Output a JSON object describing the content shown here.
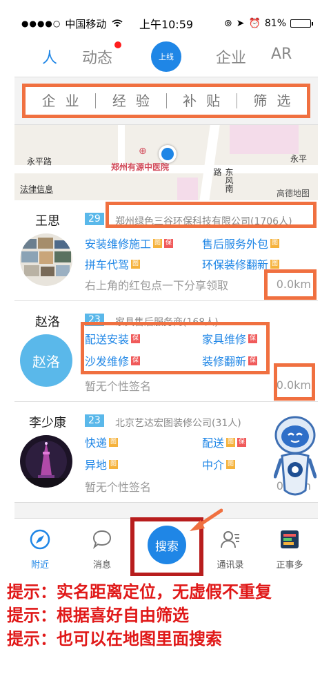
{
  "status": {
    "carrier": "中国移动",
    "time": "上午10:59",
    "battery": "81%",
    "battery_level": 0.81
  },
  "topnav": {
    "tabs": [
      "人",
      "动态",
      "企业",
      "AR"
    ],
    "active": "人",
    "online_label": "上线"
  },
  "filters": [
    "企业",
    "经验",
    "补贴",
    "筛选"
  ],
  "map": {
    "roads": [
      "永平路",
      "永平路",
      "东风南路",
      "法律信息",
      "永平"
    ],
    "poi": "郑州有源中医院",
    "brand": "高德地图"
  },
  "people": [
    {
      "name": "王思",
      "age": "29",
      "company": "郑州绿色三谷环保科技有限公司(1706人)",
      "services": [
        {
          "label": "安装维修施工",
          "badges": [
            "图",
            "保"
          ]
        },
        {
          "label": "售后服务外包",
          "badges": [
            "图"
          ]
        },
        {
          "label": "拼车代驾",
          "badges": [
            "图"
          ]
        },
        {
          "label": "环保装修翻新",
          "badges": [
            "图"
          ]
        }
      ],
      "signature": "右上角的红包点一下分享领取",
      "distance": "0.0km"
    },
    {
      "name": "赵洛",
      "avatar_text": "赵洛",
      "age": "23",
      "company": "家具售后服务商(168人)",
      "services": [
        {
          "label": "配送安装",
          "badges": [
            "保"
          ]
        },
        {
          "label": "家具维修",
          "badges": [
            "保"
          ]
        },
        {
          "label": "沙发维修",
          "badges": [
            "保"
          ]
        },
        {
          "label": "装修翻新",
          "badges": [
            "保"
          ]
        }
      ],
      "signature": "暂无个性签名",
      "distance": "0.0km"
    },
    {
      "name": "李少康",
      "age": "23",
      "company": "北京艺达宏图装修公司(31人)",
      "services": [
        {
          "label": "快递",
          "badges": [
            "图"
          ]
        },
        {
          "label": "配送",
          "badges": [
            "图",
            "保"
          ]
        },
        {
          "label": "异地",
          "badges": [
            "图"
          ]
        },
        {
          "label": "中介",
          "badges": [
            "图"
          ]
        }
      ],
      "signature": "暂无个性签名",
      "distance": "0.0km"
    }
  ],
  "bottomnav": {
    "items": [
      "附近",
      "消息",
      "通讯录",
      "正事多"
    ],
    "search_label": "搜索"
  },
  "tips": [
    "提示：实名距离定位，无虚假不重复",
    "提示：根据喜好自由筛选",
    "提示：也可以在地图里面搜索"
  ],
  "colors": {
    "accent": "#1f86e6",
    "highlight": "#f07040",
    "tip_red": "#e01818",
    "frame_red": "#b81d1d"
  }
}
